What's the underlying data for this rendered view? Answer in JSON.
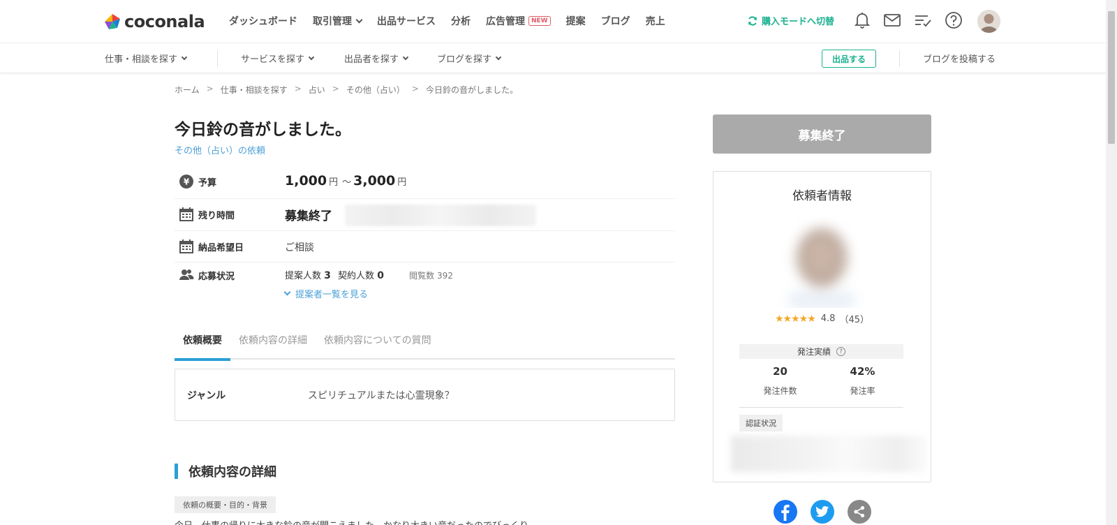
{
  "brand": {
    "logo_text": "coconala",
    "accent": "#1bb18f",
    "link": "#4a9fd8",
    "tab_active": "#2a9fd6",
    "star": "#f5a623",
    "badge": "#e05a66"
  },
  "header": {
    "nav": [
      "ダッシュボード",
      "取引管理",
      "出品サービス",
      "分析",
      "広告管理",
      "提案",
      "ブログ",
      "売上"
    ],
    "new_badge": "NEW",
    "buyer_mode": "購入モードへ切替",
    "icons": [
      "bell-icon",
      "mail-icon",
      "list-check-icon",
      "help-icon"
    ]
  },
  "subnav": {
    "find_work": "仕事・相談を探す",
    "find_service": "サービスを探す",
    "find_seller": "出品者を探す",
    "find_blog": "ブログを探す",
    "sell": "出品する",
    "post_blog": "ブログを投稿する"
  },
  "breadcrumb": [
    "ホーム",
    "仕事・相談を探す",
    "占い",
    "その他（占い）",
    "今日鈴の音がしました。"
  ],
  "breadcrumb_sep": ">",
  "request": {
    "title": "今日鈴の音がしました。",
    "category_link": "その他（占い）の依頼",
    "budget_label": "予算",
    "budget_min": "1,000",
    "budget_max": "3,000",
    "yen": "円",
    "tilde": "～",
    "remaining_label": "残り時間",
    "remaining_value": "募集終了",
    "delivery_label": "納品希望日",
    "delivery_value": "ご相談",
    "status_label": "応募状況",
    "proposals_label": "提案人数",
    "proposals": "3",
    "contracts_label": "契約人数",
    "contracts": "0",
    "views_label": "閲覧数",
    "views": "392",
    "proposer_list": "提案者一覧を見る"
  },
  "tabs": [
    "依頼概要",
    "依頼内容の詳細",
    "依頼内容についての質問"
  ],
  "genre": {
    "label": "ジャンル",
    "value": "スピリチュアルまたは心霊現象？"
  },
  "details": {
    "heading": "依頼内容の詳細",
    "tag": "依頼の概要・目的・背景",
    "text": "今日、仕事の帰りに大きな鈴の音が聞こえました。かなり大きい音だったのでびっくり"
  },
  "sidebar": {
    "closed_button": "募集終了",
    "client_title": "依頼者情報",
    "stars": "★★★★★",
    "rating": "4.8",
    "reviews": "（45）",
    "order_head": "発注実績",
    "orders": "20",
    "orders_label": "発注件数",
    "order_rate": "42%",
    "order_rate_label": "発注率",
    "verify": "認証状況"
  },
  "share": [
    "facebook-icon",
    "twitter-icon",
    "share-icon"
  ]
}
